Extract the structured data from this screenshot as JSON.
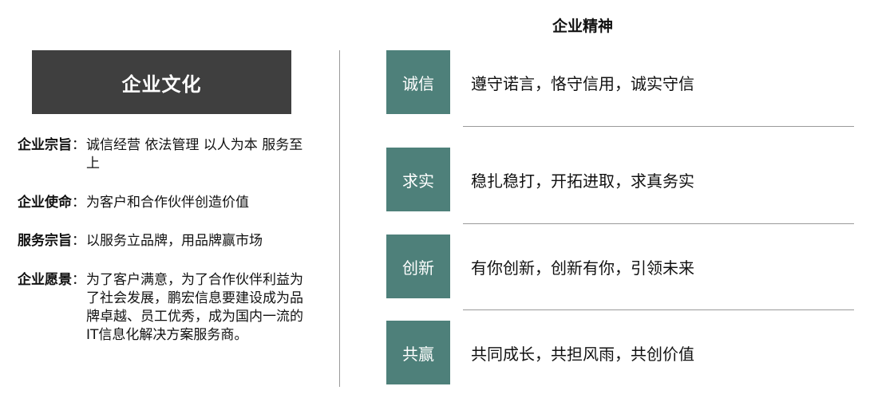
{
  "culture": {
    "title": "企业文化",
    "items": [
      {
        "label": "企业宗旨",
        "colon": "：",
        "text": "诚信经营 依法管理 以人为本 服务至上"
      },
      {
        "label": "企业使命",
        "colon": "：",
        "text": "为客户和合作伙伴创造价值"
      },
      {
        "label": "服务宗旨",
        "colon": "：",
        "text": "以服务立品牌，用品牌赢市场"
      },
      {
        "label": "企业愿景",
        "colon": "：",
        "text": "为了客户满意，为了合作伙伴利益为了社会发展，鹏宏信息要建设成为品牌卓越、员工优秀，成为国内一流的IT信息化解决方案服务商。"
      }
    ]
  },
  "spirit": {
    "title": "企业精神",
    "colors": {
      "box": "#4e807a",
      "banner": "#3f3f3f"
    },
    "rows": [
      {
        "key": "诚信",
        "text": "遵守诺言，恪守信用，诚实守信"
      },
      {
        "key": "求实",
        "text": "稳扎稳打，开拓进取，求真务实"
      },
      {
        "key": "创新",
        "text": "有你创新，创新有你，引领未来"
      },
      {
        "key": "共赢",
        "text": "共同成长，共担风雨，共创价值"
      }
    ]
  }
}
